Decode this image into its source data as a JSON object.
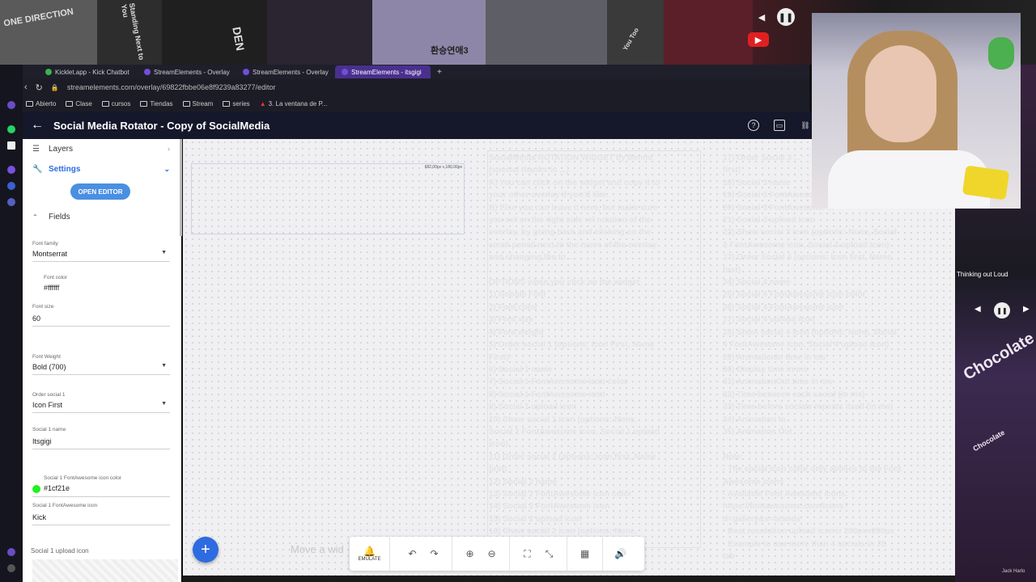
{
  "banner": {
    "tiles": [
      "ONE DIRECTION",
      "Standing Next to You",
      "DEN",
      "환승연애3",
      "You Too"
    ],
    "youtube_icon": "youtube-icon",
    "pause_icon": "pause-icon"
  },
  "browser": {
    "tabs": [
      "Kicklet.app - Kick Chatbot",
      "StreamElements - Overlay",
      "StreamElements - Overlay",
      "StreamElements - itsgigi"
    ],
    "new_tab": "+",
    "url": "streamelements.com/overlay/69822fbbe06e8f9239a83277/editor",
    "bookmarks": [
      "Abierto",
      "Clase",
      "cursos",
      "Tiendas",
      "Stream",
      "series",
      "3. La ventana de P..."
    ]
  },
  "app": {
    "title": "Social Media Rotator - Copy of SocialMedia",
    "back": "←",
    "help_icon": "?",
    "monitor_icon": "▭",
    "link_icon": "🔗"
  },
  "sidebar": {
    "layers": "Layers",
    "settings": "Settings",
    "open_editor": "OPEN EDITOR",
    "fields": "Fields",
    "items": [
      {
        "label": "Font family",
        "value": "Montserrat"
      },
      {
        "label": "Font color",
        "value": "#ffffff"
      },
      {
        "label": "Font size",
        "value": "60"
      },
      {
        "label": "Font Weight",
        "value": "Bold (700)"
      },
      {
        "label": "Order social 1",
        "value": "Icon First"
      },
      {
        "label": "Social 1 name",
        "value": "Itsgigi"
      },
      {
        "label": "Social 1 FontAwesome icon color",
        "value": "#1cf21e"
      },
      {
        "label": "Social 1 FontAwesome icon",
        "value": "Kick"
      }
    ],
    "upload_label": "Social 1 upload icon",
    "colors": {
      "font_color": "#ffffff",
      "icon_color": "#1cf21e"
    }
  },
  "canvas": {
    "selection_size": "682.00px x 180.00px",
    "move_hint": "Move a wid",
    "col1": "SocialMedia ROTATION WIDGET by Benno\n(special thanks to ...)\nA) You can click on the widget and copy it to\nyour other overlay if you'd like.\nB) Else you can leave it here, but make sure\nyou set on the right side rel rotation of the\noverlay, by going back and clicking on the\nsmall pencil next to the name of the overlay\nand changing the to ...\n\nOPTIONS when you click on the widget\n1) Google Font\n2) Font color\n3) Font size\n4) Font weight\n5) Order social 1 (options: Icon First, Name\nFirst)\n6) Social 1 name\n7) Social 1 FontAwesome icon color\n8) Social 1 FontAwesome icon\n9) Social 1 upload icon\n10) Show social 1 icon (options: None,\nSocial 1 FontAwesome icon, Social 1 upload\nicon)\n11) Order social 2 (options: Icon first, Name\nfirst)\n12) Social 2 name\n13) Social 2 FontAwesome icon color\n14) Social 2 FontAwesome icon\n15) Social 2 upload icon\n16) Show social 2 icon (options: None,\n...)",
    "col2": "17) Order Social 3 ...\nfirst)\n18) Social 3 name\n19) Social 3 FontAwesome ...\n20) Social 3 FontAwesome ...\n21) Social 3 upload icon\n22) Show social 3 icon (options: None, Social\n3 FontAwesome icon, Social 3 upload icon)\n23) Order Social 4 (options: Icon first, Name\nfirst)\n24) Social 4 name\n25) Social 4 FontAwesome icon color\n26) Social 4 FontAwesome icon\n27) Social 4 upload icon\n28) Show social 4 icon (options: None, Social\n4 FontAwesome icon, Social 4 upload icon)\n29) AnimationIn time in ms\n30) Display time in ms\n31) AnimationOut time in ms\n32) Time between each social (in ms)\n33) Time before socials repeats itself (in ms)\n34) Animation In\n35) Animation Out\n\nNote:\n- The social icon color only applies to the Font\nAwesome icons\n- Available Font Awesome icons:\nhttps://fontawesome.com/icons?\nd=gallery&s=brands\n- Best resolution upload icons: 200px×200px\n- Example to use more than 4 socials in JS\ntab"
  },
  "toolbar": {
    "emulate": "EMULATE",
    "add": "+"
  },
  "rightpanel": {
    "track": "Thinking out Loud",
    "album": "Chocolate",
    "credit": "Jack Harlo"
  }
}
